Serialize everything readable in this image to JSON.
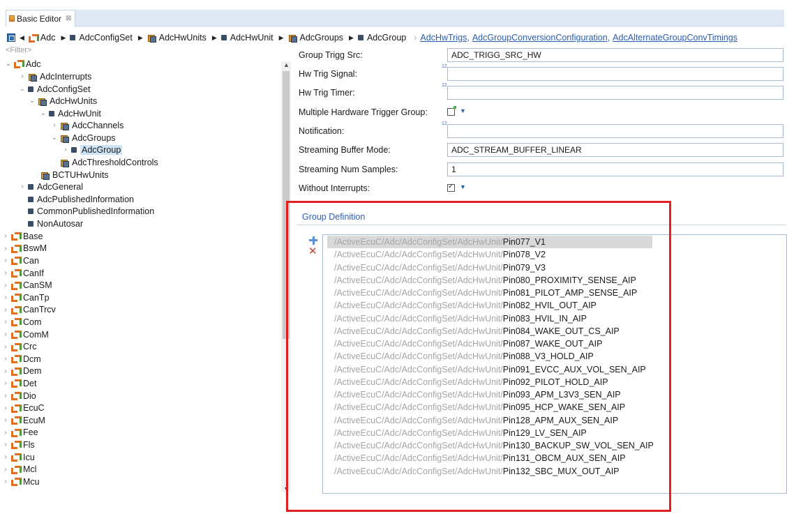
{
  "tab": {
    "title": "Basic Editor",
    "close": "⊠"
  },
  "breadcrumb": {
    "items": [
      "Adc",
      "AdcConfigSet",
      "AdcHwUnits",
      "AdcHwUnit",
      "AdcGroups",
      "AdcGroup"
    ],
    "links": [
      "AdcHwTrigs",
      "AdcGroupConversionConfiguration",
      "AdcAlternateGroupConvTimings"
    ]
  },
  "filter": {
    "placeholder": "<Filter>"
  },
  "tree": {
    "adc": "Adc",
    "adc_interrupts": "AdcInterrupts",
    "adc_config_set": "AdcConfigSet",
    "adc_hw_units": "AdcHwUnits",
    "adc_hw_unit": "AdcHwUnit",
    "adc_channels": "AdcChannels",
    "adc_groups": "AdcGroups",
    "adc_group": "AdcGroup",
    "adc_threshold_controls": "AdcThresholdControls",
    "bctu_hw_units": "BCTUHwUnits",
    "adc_general": "AdcGeneral",
    "adc_published_information": "AdcPublishedInformation",
    "common_published_information": "CommonPublishedInformation",
    "non_autosar": "NonAutosar",
    "modules": [
      "Base",
      "BswM",
      "Can",
      "CanIf",
      "CanSM",
      "CanTp",
      "CanTrcv",
      "Com",
      "ComM",
      "Crc",
      "Dcm",
      "Dem",
      "Det",
      "Dio",
      "EcuC",
      "EcuM",
      "Fee",
      "Fls",
      "Icu",
      "Mcl",
      "Mcu"
    ]
  },
  "form": {
    "group_trigg_src": {
      "label": "Group Trigg Src:",
      "value": "ADC_TRIGG_SRC_HW"
    },
    "hw_trig_signal": {
      "label": "Hw Trig Signal:",
      "value": ""
    },
    "hw_trig_timer": {
      "label": "Hw Trig Timer:",
      "value": ""
    },
    "multiple_hw_trigger_group": {
      "label": "Multiple Hardware Trigger Group:",
      "checked": false
    },
    "notification": {
      "label": "Notification:",
      "value": ""
    },
    "streaming_buffer_mode": {
      "label": "Streaming Buffer Mode:",
      "value": "ADC_STREAM_BUFFER_LINEAR"
    },
    "streaming_num_samples": {
      "label": "Streaming Num Samples:",
      "value": "1"
    },
    "without_interrupts": {
      "label": "Without Interrupts:",
      "checked": true
    }
  },
  "group_definition": {
    "title": "Group Definition",
    "path_prefix": "/ActiveEcuC/Adc/AdcConfigSet/AdcHwUnit/",
    "pins": [
      "Pin077_V1",
      "Pin078_V2",
      "Pin079_V3",
      "Pin080_PROXIMITY_SENSE_AIP",
      "Pin081_PILOT_AMP_SENSE_AIP",
      "Pin082_HVIL_OUT_AIP",
      "Pin083_HVIL_IN_AIP",
      "Pin084_WAKE_OUT_CS_AIP",
      "Pin087_WAKE_OUT_AIP",
      "Pin088_V3_HOLD_AIP",
      "Pin091_EVCC_AUX_VOL_SEN_AIP",
      "Pin092_PILOT_HOLD_AIP",
      "Pin093_APM_L3V3_SEN_AIP",
      "Pin095_HCP_WAKE_SEN_AIP",
      "Pin128_APM_AUX_SEN_AIP",
      "Pin129_LV_SEN_AIP",
      "Pin130_BACKUP_SW_VOL_SEN_AIP",
      "Pin131_OBCM_AUX_SEN_AIP",
      "Pin132_SBC_MUX_OUT_AIP"
    ]
  },
  "colors": {
    "highlight": "#e02020",
    "link": "#2a5db0",
    "selection": "#cde4f7"
  }
}
